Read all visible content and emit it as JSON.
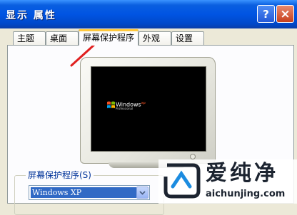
{
  "window": {
    "title": "显示 属性",
    "help_glyph": "?",
    "close_glyph": "×"
  },
  "tabs": [
    {
      "label": "主题",
      "active": false
    },
    {
      "label": "桌面",
      "active": false
    },
    {
      "label": "屏幕保护程序",
      "active": true
    },
    {
      "label": "外观",
      "active": false
    },
    {
      "label": "设置",
      "active": false
    }
  ],
  "preview": {
    "logo_word": "Windows",
    "logo_sup": "xp",
    "logo_edition": "Professional"
  },
  "screensaver_group": {
    "label": "屏幕保护程序(S)",
    "selected": "Windows XP"
  },
  "watermark": {
    "title": "爱纯净",
    "url": "aichunjing.com"
  },
  "colors": {
    "titlebar": "#0054E3",
    "dialog_bg": "#ECE9D8",
    "selection": "#316AC5",
    "arrow": "#E02020"
  },
  "icons": [
    "help-icon",
    "close-icon",
    "windows-logo-icon",
    "dropdown-arrow-icon",
    "red-arrow-icon",
    "aichunjing-logo-icon"
  ]
}
